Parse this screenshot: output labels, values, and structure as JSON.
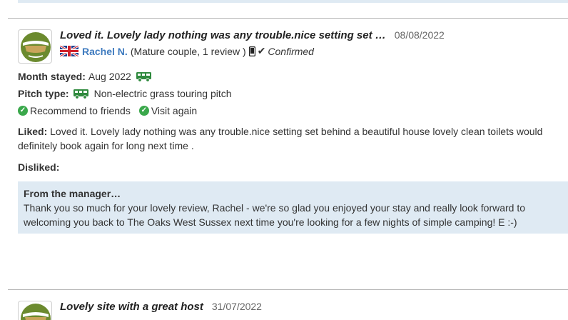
{
  "reviews": [
    {
      "title": "Loved it. Lovely lady nothing was any trouble.nice setting set …",
      "date": "08/08/2022",
      "author": "Rachel N.",
      "reviewer_meta": "(Mature couple, 1 review )",
      "confirmed": "Confirmed",
      "month_label": "Month stayed:",
      "month_value": "Aug 2022",
      "pitch_label": "Pitch type:",
      "pitch_value": "Non-electric grass touring pitch",
      "recommend": "Recommend to friends",
      "visit_again": "Visit again",
      "liked_label": "Liked:",
      "liked_text": "Loved it. Lovely lady nothing was any trouble.nice setting set behind a beautiful house lovely clean toilets would definitely book again for long next time .",
      "disliked_label": "Disliked:",
      "manager_title": "From the manager…",
      "manager_text": "Thank you so much for your lovely review, Rachel - we're so glad you enjoyed your stay and really look forward to welcoming you back to The Oaks West Sussex next time you're looking for a few nights of simple camping! E :-)"
    },
    {
      "title": "Lovely site with a great host",
      "date": "31/07/2022"
    }
  ],
  "icons": {
    "avatar": "avatar-icon",
    "flag": "uk-flag-icon",
    "device": "mobile-phone-icon",
    "confirmed": "checkmark-icon",
    "campervan": "campervan-icon",
    "recommend": "check-circle-icon"
  },
  "colors": {
    "author_link": "#3f7bbf",
    "manager_bg": "#dfeaf3",
    "check_green": "#3aa84b",
    "avatar_olive": "#6b8a2e"
  }
}
